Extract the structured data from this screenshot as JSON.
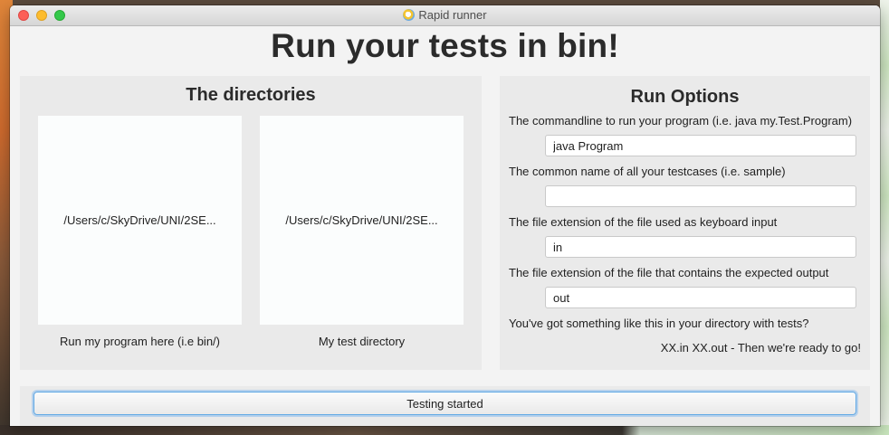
{
  "window": {
    "title": "Rapid runner",
    "app_icon": "magnifier-icon"
  },
  "headline": "Run your tests in bin!",
  "directories": {
    "title": "The directories",
    "program_dir": {
      "path": "/Users/c/SkyDrive/UNI/2SE...",
      "caption": "Run my program here (i.e bin/)"
    },
    "test_dir": {
      "path": "/Users/c/SkyDrive/UNI/2SE...",
      "caption": "My test directory"
    }
  },
  "run_options": {
    "title": "Run Options",
    "commandline": {
      "label": "The commandline to run your program (i.e. java my.Test.Program)",
      "value": "java Program"
    },
    "testcase_name": {
      "label": "The common name of all your testcases (i.e. sample)",
      "value": ""
    },
    "input_ext": {
      "label": "The file extension of the file used as keyboard input",
      "value": "in"
    },
    "output_ext": {
      "label": "The file extension of the file that contains the expected output",
      "value": "out"
    },
    "question": "You've got something like this in your directory with tests?",
    "ready_text": "XX.in XX.out - Then we're ready to go!"
  },
  "status_button": {
    "label": "Testing started"
  },
  "colors": {
    "focus_ring": "#5fa8e4",
    "panel_bg": "#eaeaea",
    "window_bg": "#f3f3f3"
  }
}
